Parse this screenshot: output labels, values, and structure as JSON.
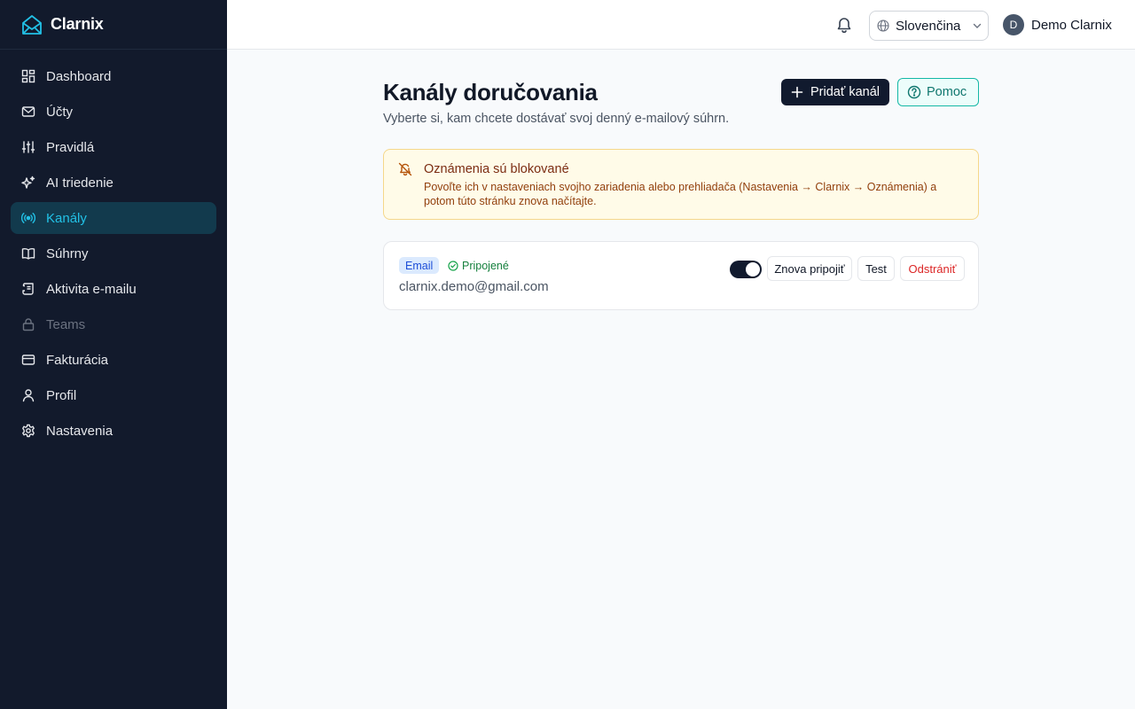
{
  "brand": {
    "name": "Clarnix",
    "accent": "#22c1e6"
  },
  "sidebar": {
    "items": [
      {
        "label": "Dashboard",
        "icon": "dashboard-icon",
        "active": false,
        "disabled": false
      },
      {
        "label": "Účty",
        "icon": "mail-icon",
        "active": false,
        "disabled": false
      },
      {
        "label": "Pravidlá",
        "icon": "sliders-icon",
        "active": false,
        "disabled": false
      },
      {
        "label": "AI triedenie",
        "icon": "sparkles-icon",
        "active": false,
        "disabled": false
      },
      {
        "label": "Kanály",
        "icon": "broadcast-icon",
        "active": true,
        "disabled": false
      },
      {
        "label": "Súhrny",
        "icon": "book-icon",
        "active": false,
        "disabled": false
      },
      {
        "label": "Aktivita e-mailu",
        "icon": "scroll-icon",
        "active": false,
        "disabled": false
      },
      {
        "label": "Teams",
        "icon": "lock-icon",
        "active": false,
        "disabled": true
      },
      {
        "label": "Fakturácia",
        "icon": "credit-card-icon",
        "active": false,
        "disabled": false
      },
      {
        "label": "Profil",
        "icon": "user-icon",
        "active": false,
        "disabled": false
      },
      {
        "label": "Nastavenia",
        "icon": "gear-icon",
        "active": false,
        "disabled": false
      }
    ]
  },
  "topbar": {
    "language": "Slovenčina",
    "user_initial": "D",
    "user_name": "Demo Clarnix"
  },
  "page": {
    "title": "Kanály doručovania",
    "subtitle": "Vyberte si, kam chcete dostávať svoj denný e-mailový súhrn.",
    "add_button": "Pridať kanál",
    "help_button": "Pomoc"
  },
  "alert": {
    "title": "Oznámenia sú blokované",
    "body": "Povoľte ich v nastaveniach svojho zariadenia alebo prehliadača (Nastavenia → Clarnix → Oznámenia) a potom túto stránku znova načítajte."
  },
  "channel": {
    "type_label": "Email",
    "status_label": "Pripojené",
    "address": "clarnix.demo@gmail.com",
    "enabled": true,
    "reconnect_label": "Znova pripojiť",
    "test_label": "Test",
    "remove_label": "Odstrániť"
  }
}
